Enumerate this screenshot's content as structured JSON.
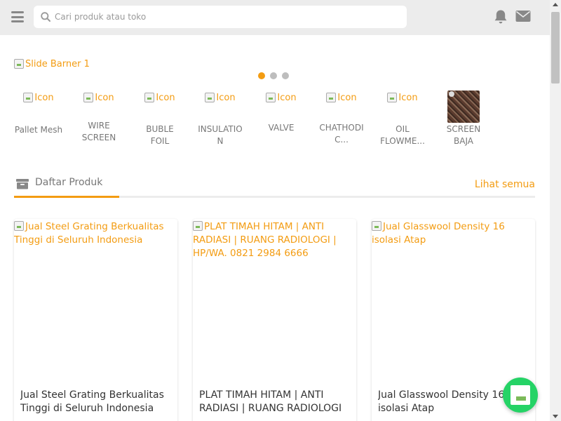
{
  "header": {
    "search_placeholder": "Cari produk atau toko",
    "icons": [
      "menu-icon",
      "search-icon",
      "bell-icon",
      "mail-icon"
    ]
  },
  "banner": {
    "alt": "Slide Barner 1",
    "dots": 3,
    "active_dot": 1
  },
  "categories": [
    {
      "icon_alt": "Icon",
      "label": "Pallet Mesh"
    },
    {
      "icon_alt": "Icon",
      "label": "WIRE SCREEN"
    },
    {
      "icon_alt": "Icon",
      "label": "BUBLE FOIL"
    },
    {
      "icon_alt": "Icon",
      "label": "INSULATION"
    },
    {
      "icon_alt": "Icon",
      "label": "VALVE"
    },
    {
      "icon_alt": "Icon",
      "label": "CHATHODIC..."
    },
    {
      "icon_alt": "Icon",
      "label": "OIL FLOWME..."
    },
    {
      "icon_alt": "",
      "label": "SCREEN BAJA"
    }
  ],
  "section": {
    "title": "Daftar Produk",
    "see_all": "Lihat semua"
  },
  "products": [
    {
      "img_alt": "Jual Steel Grating Berkualitas Tinggi di Seluruh Indonesia",
      "title": "Jual Steel Grating Berkualitas Tinggi di Seluruh Indonesia"
    },
    {
      "img_alt": "PLAT TIMAH HITAM | ANTI RADIASI | RUANG RADIOLOGI | HP/WA. 0821 2984 6666",
      "title": "PLAT TIMAH HITAM | ANTI RADIASI | RUANG RADIOLOGI |..."
    },
    {
      "img_alt": "Jual Glasswool Density 16 isolasi Atap",
      "title": "Jual Glasswool Density 16 isolasi Atap"
    }
  ],
  "colors": {
    "accent": "#f39c12",
    "header_bg": "#ececec",
    "whatsapp": "#25d366"
  }
}
